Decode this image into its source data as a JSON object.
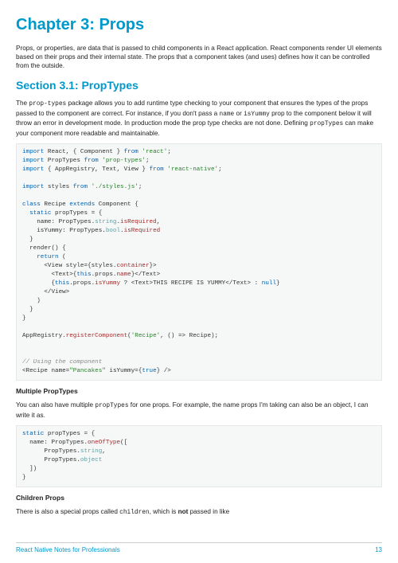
{
  "chapter": {
    "title": "Chapter 3: Props"
  },
  "intro": "Props, or properties, are data that is passed to child components in a React application. React components render UI elements based on their props and their internal state. The props that a component takes (and uses) defines how it can be controlled from the outside.",
  "section": {
    "title": "Section 3.1: PropTypes",
    "p1a": "The ",
    "p1code1": "prop-types",
    "p1b": " package allows you to add runtime type checking to your component that ensures the types of the props passed to the component are correct. For instance, if you don't pass a ",
    "p1code2": "name",
    "p1c": " or ",
    "p1code3": "isYummy",
    "p1d": " prop to the component below it will throw an error in development mode. In production mode the prop type checks are not done. Defining ",
    "p1code4": "propTypes",
    "p1e": " can make your component more readable and maintainable."
  },
  "code1": {
    "l01a": "import",
    "l01b": " React, { Component } ",
    "l01c": "from",
    "l01d": " 'react'",
    "l01e": ";",
    "l02a": "import",
    "l02b": " PropTypes ",
    "l02c": "from",
    "l02d": " 'prop-types'",
    "l02e": ";",
    "l03a": "import",
    "l03b": " { AppRegistry, Text, View } ",
    "l03c": "from",
    "l03d": " 'react-native'",
    "l03e": ";",
    "l04": "",
    "l05a": "import",
    "l05b": " styles ",
    "l05c": "from",
    "l05d": " './styles.js'",
    "l05e": ";",
    "l06": "",
    "l07a": "class",
    "l07b": " Recipe ",
    "l07c": "extends",
    "l07d": " Component {",
    "l08a": "  static",
    "l08b": " propTypes = {",
    "l09a": "    name: PropTypes.",
    "l09b": "string",
    "l09c": ".",
    "l09d": "isRequired",
    "l09e": ",",
    "l10a": "    isYummy: PropTypes.",
    "l10b": "bool",
    "l10c": ".",
    "l10d": "isRequired",
    "l11": "  }",
    "l12": "  render() {",
    "l13a": "    return",
    "l13b": " (",
    "l14a": "      <View style={styles.",
    "l14b": "container",
    "l14c": "}>",
    "l15a": "        <Text>{",
    "l15b": "this",
    "l15c": ".props.",
    "l15d": "name",
    "l15e": "}</Text>",
    "l16a": "        {",
    "l16b": "this",
    "l16c": ".props.",
    "l16d": "isYummy",
    "l16e": " ? <Text>THIS RECIPE IS YUMMY</Text> : ",
    "l16f": "null",
    "l16g": "}",
    "l17": "      </View>",
    "l18": "    )",
    "l19": "  }",
    "l20": "}",
    "l21": "",
    "l22a": "AppRegistry.",
    "l22b": "registerComponent",
    "l22c": "(",
    "l22d": "'Recipe'",
    "l22e": ", () => Recipe);",
    "l23": "",
    "l24": "",
    "l25": "// Using the component",
    "l26a": "<Recipe name=",
    "l26b": "\"Pancakes\"",
    "l26c": " isYummy={",
    "l26d": "true",
    "l26e": "} />"
  },
  "multi": {
    "heading": "Multiple PropTypes",
    "p1a": "You can also have multiple ",
    "p1code": "propTypes",
    "p1b": " for one props. For example, the name props I'm taking can also be an object, I can write it as."
  },
  "code2": {
    "l1a": "static",
    "l1b": " propTypes = {",
    "l2a": "  name: PropTypes.",
    "l2b": "oneOfType",
    "l2c": "([",
    "l3a": "      PropTypes.",
    "l3b": "string",
    "l3c": ",",
    "l4a": "      PropTypes.",
    "l4b": "object",
    "l5": "  ])",
    "l6": "}"
  },
  "children": {
    "heading": "Children Props",
    "p1a": "There is also a special props called ",
    "p1code": "children",
    "p1b": ", which is ",
    "p1bold": "not",
    "p1c": " passed in like"
  },
  "footer": {
    "left": "React Native Notes for Professionals",
    "right": "13"
  }
}
